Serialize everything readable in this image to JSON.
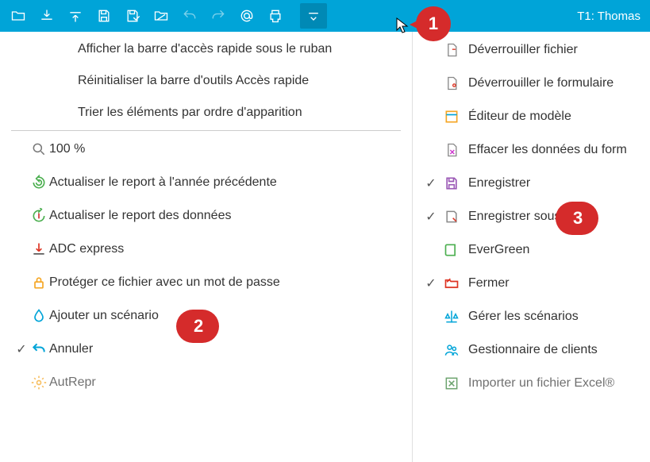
{
  "toolbar": {
    "right_label": "T1: Thomas"
  },
  "left_menu": {
    "items": [
      {
        "label": "Afficher la barre d'accès rapide sous le ruban"
      },
      {
        "label": "Réinitialiser la barre d'outils Accès rapide"
      },
      {
        "label": "Trier les éléments par ordre d'apparition"
      }
    ],
    "group2": [
      {
        "label": "100 %"
      },
      {
        "label": "Actualiser le report à l'année précédente"
      },
      {
        "label": "Actualiser le report des données"
      },
      {
        "label": "ADC express"
      },
      {
        "label": "Protéger ce fichier avec un mot de passe"
      },
      {
        "label": "Ajouter un scénario"
      },
      {
        "label": "Annuler",
        "checked": true
      },
      {
        "label": "AutRepr"
      }
    ]
  },
  "right_menu": {
    "items": [
      {
        "label": "Déverrouiller fichier"
      },
      {
        "label": "Déverrouiller le formulaire"
      },
      {
        "label": "Éditeur de modèle"
      },
      {
        "label": "Effacer les données du form"
      },
      {
        "label": "Enregistrer",
        "checked": true
      },
      {
        "label": "Enregistrer sous",
        "checked": true
      },
      {
        "label": "EverGreen"
      },
      {
        "label": "Fermer",
        "checked": true
      },
      {
        "label": "Gérer les scénarios"
      },
      {
        "label": "Gestionnaire de clients"
      },
      {
        "label": "Importer un fichier Excel®"
      }
    ]
  },
  "callouts": {
    "c1": "1",
    "c2": "2",
    "c3": "3"
  }
}
